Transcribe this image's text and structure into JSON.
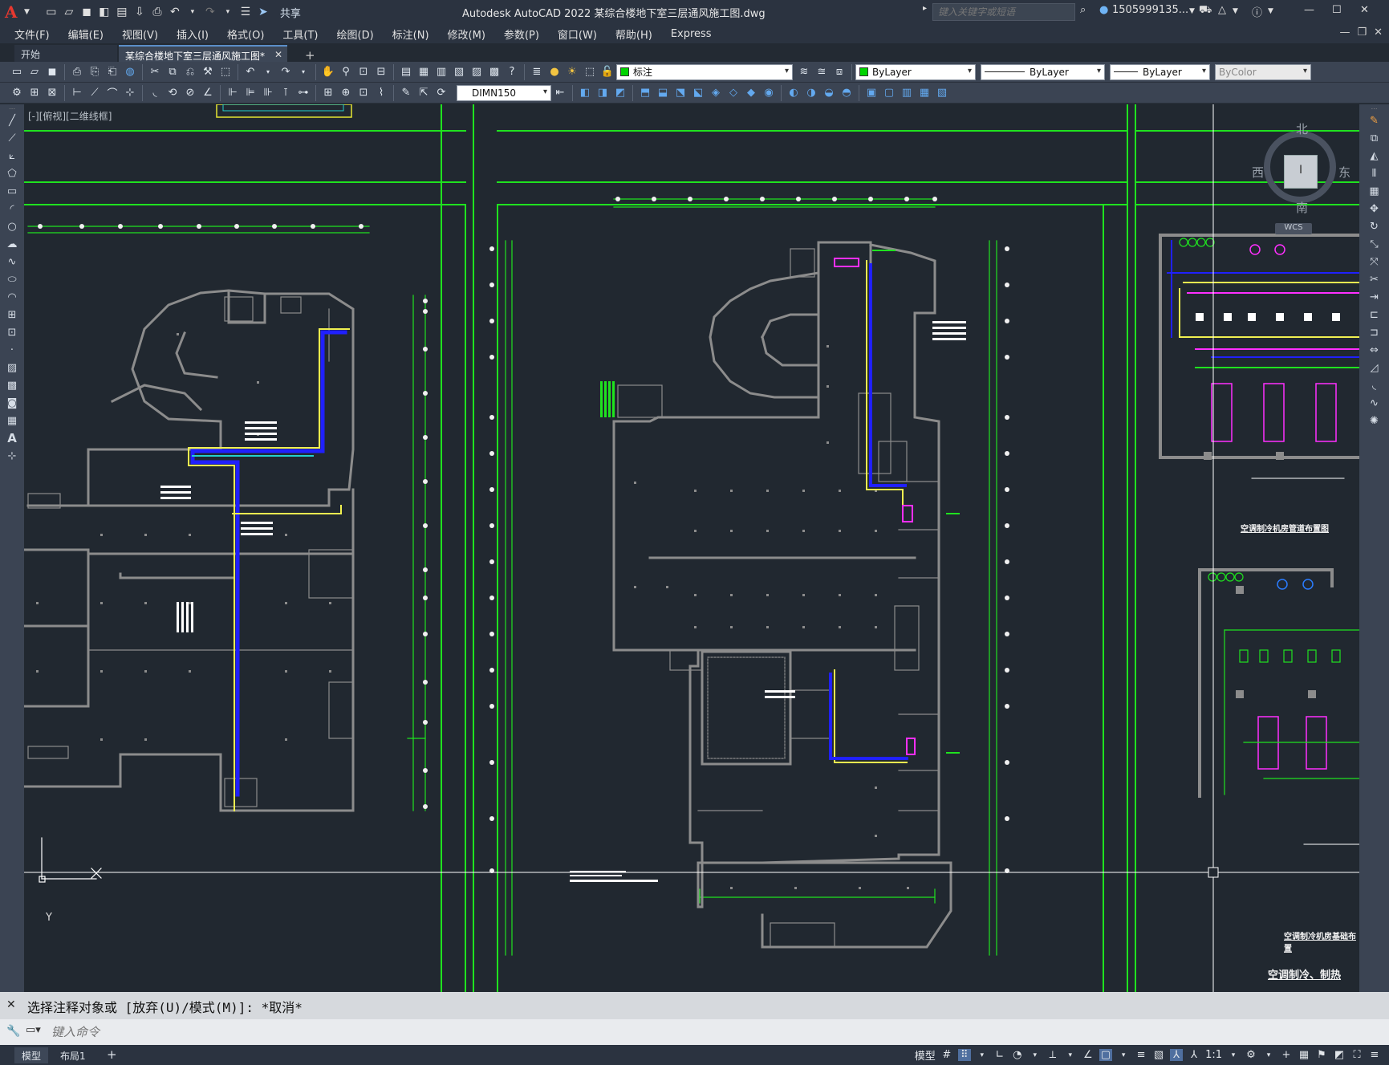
{
  "app": {
    "title": "Autodesk AutoCAD 2022    某综合楼地下室三层通风施工图.dwg",
    "logo": "A",
    "share_label": "共享"
  },
  "search": {
    "placeholder": "键入关键字或短语"
  },
  "user": {
    "name": "1505999135..."
  },
  "menu": [
    "文件(F)",
    "编辑(E)",
    "视图(V)",
    "插入(I)",
    "格式(O)",
    "工具(T)",
    "绘图(D)",
    "标注(N)",
    "修改(M)",
    "参数(P)",
    "窗口(W)",
    "帮助(H)",
    "Express"
  ],
  "tabs": {
    "start": "开始",
    "doc": "某综合楼地下室三层通风施工图*",
    "add": "+"
  },
  "properties": {
    "layer": "标注",
    "color": "ByLayer",
    "linetype": "ByLayer",
    "lineweight": "ByLayer",
    "plotstyle": "ByColor",
    "dimstyle": "DIMN150",
    "layer_color": "#00d400"
  },
  "viewport": {
    "label": "[-][俯视][二维线框]"
  },
  "viewcube": {
    "north": "北",
    "south": "南",
    "east": "东",
    "west": "西",
    "wcs": "WCS"
  },
  "ucs": {
    "y": "Y"
  },
  "drawing_labels": {
    "room1": "空调制冷机房管道布置图",
    "room2": "空调制冷机房基础布置",
    "bottom_title": "空调制冷、制热"
  },
  "command": {
    "history": "选择注释对象或 [放弃(U)/模式(M)]: *取消*",
    "placeholder": "键入命令"
  },
  "status": {
    "model": "模型",
    "layout1": "布局1",
    "add": "+",
    "model_label": "模型",
    "scale": "1:1"
  },
  "colors": {
    "bg": "#212830",
    "wall": "#8c8c8c",
    "axis": "#22ff22",
    "duct_yellow": "#f0f050",
    "duct_blue": "#2020ff",
    "magenta": "#ff2fff"
  }
}
